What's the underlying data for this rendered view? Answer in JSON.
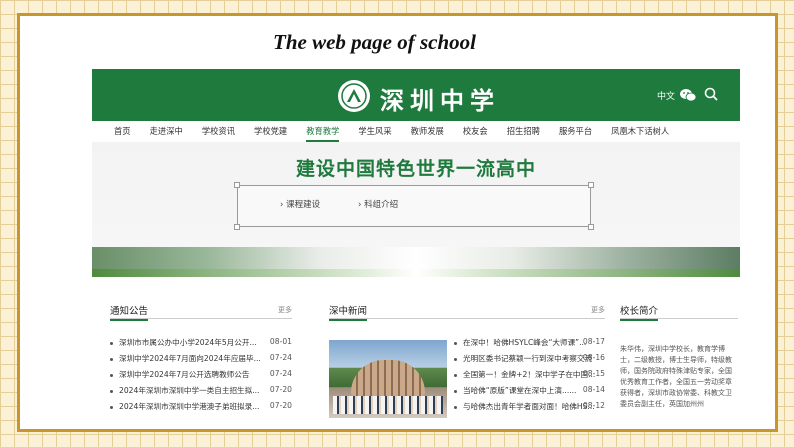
{
  "slide": {
    "title": "The web page of school"
  },
  "site": {
    "logo_text": "深圳中学",
    "lang_label": "中文",
    "icons": [
      "wechat-icon",
      "search-icon"
    ],
    "accent": "#1f7a3e",
    "nav": [
      "首页",
      "走进深中",
      "学校资讯",
      "学校党建",
      "教育教学",
      "学生风采",
      "教师发展",
      "校友会",
      "招生招聘",
      "服务平台",
      "凤凰木下话树人"
    ],
    "nav_active_index": 4,
    "banner_title": "建设中国特色世界一流高中",
    "sub_links": [
      "课程建设",
      "科组介绍"
    ]
  },
  "notices": {
    "title": "通知公告",
    "more": "更多",
    "items": [
      {
        "text": "深圳市市属公办中小学2024年5月公开...",
        "date": "08-01"
      },
      {
        "text": "深圳中学2024年7月面向2024年应届毕...",
        "date": "07-24"
      },
      {
        "text": "深圳中学2024年7月公开选聘教师公告",
        "date": "07-24"
      },
      {
        "text": "2024年深圳市深圳中学一类自主招生拟...",
        "date": "07-20"
      },
      {
        "text": "2024年深圳市深圳中学港澳子弟班拟录...",
        "date": "07-20"
      }
    ]
  },
  "news": {
    "title": "深中新闻",
    "more": "更多",
    "items": [
      {
        "text": "在深中！哈佛HSYLC峰会“大师课”...",
        "date": "08-17"
      },
      {
        "text": "光明区委书记蔡颖一行到深中考察交流",
        "date": "08-16"
      },
      {
        "text": "全国第一！金牌+2！深中学子在中国...",
        "date": "08-15"
      },
      {
        "text": "当哈佛“原版”课堂在深中上演......",
        "date": "08-14"
      },
      {
        "text": "与哈佛杰出青年学者面对面！哈佛HS...",
        "date": "08-12"
      }
    ]
  },
  "principal": {
    "title": "校长简介",
    "text": "朱华伟，深圳中学校长，教育学博士，二级教授，博士生导师，特级教师，国务院政府特殊津贴专家，全国优秀教育工作者，全国五一劳动奖章获得者，深圳市政协常委、科教文卫委员会副主任，英国加州州"
  }
}
